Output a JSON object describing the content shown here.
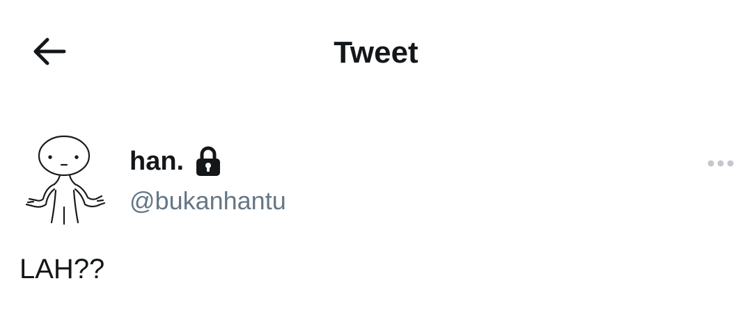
{
  "header": {
    "title": "Tweet",
    "back_icon": "arrow-left-icon"
  },
  "tweet": {
    "author": {
      "display_name": "han.",
      "handle": "@bukanhantu",
      "protected_icon": "lock-icon",
      "avatar": "shrugging-stick-figure"
    },
    "more_icon": "more-dots-icon",
    "text": "LAH??"
  },
  "colors": {
    "text_primary": "#14171a",
    "text_secondary": "#657786",
    "icon_muted": "#c4c8cc",
    "background": "#ffffff"
  }
}
